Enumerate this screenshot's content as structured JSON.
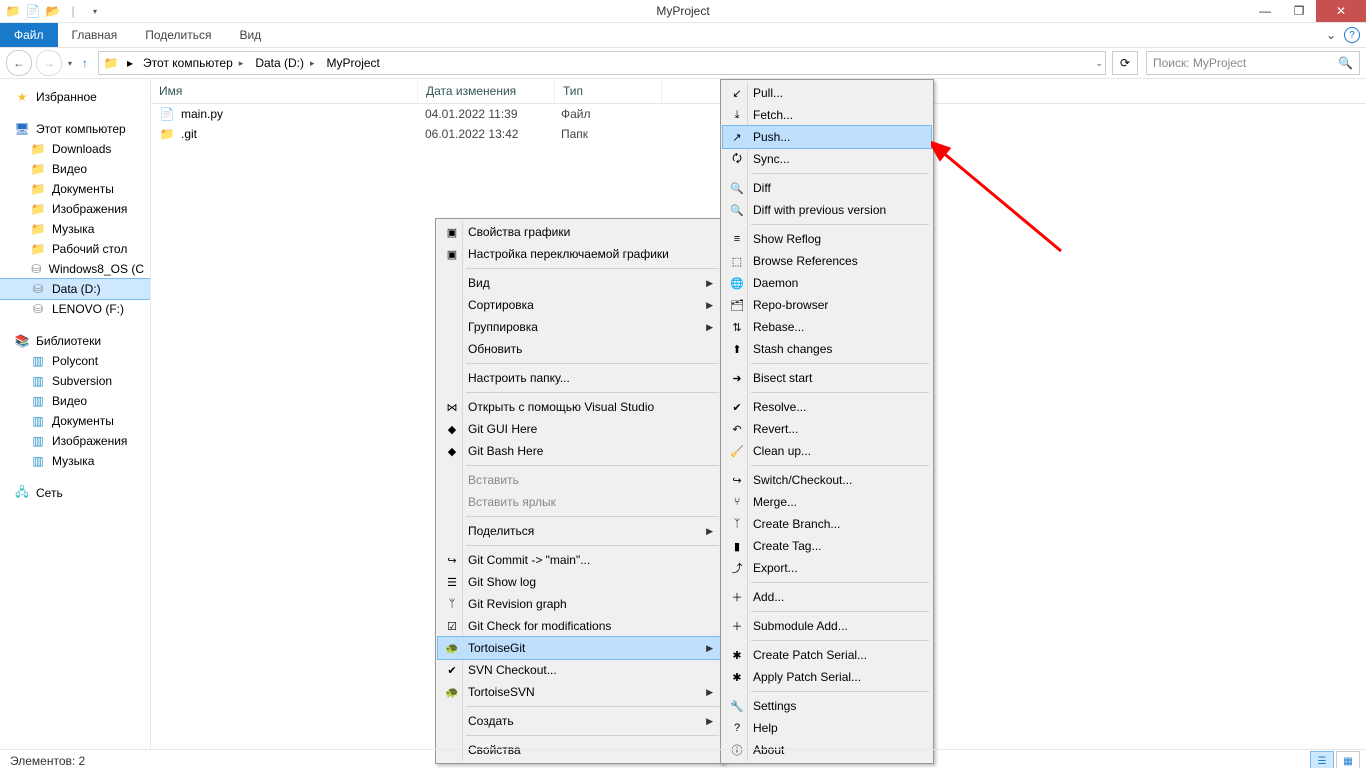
{
  "window": {
    "title": "MyProject"
  },
  "ribbon": {
    "file_tab": "Файл",
    "tabs": [
      "Главная",
      "Поделиться",
      "Вид"
    ]
  },
  "breadcrumb": {
    "segs": [
      "Этот компьютер",
      "Data (D:)",
      "MyProject"
    ]
  },
  "search": {
    "placeholder": "Поиск: MyProject"
  },
  "sidebar": {
    "favorites": {
      "label": "Избранное"
    },
    "this_pc": {
      "label": "Этот компьютер",
      "items": [
        "Downloads",
        "Видео",
        "Документы",
        "Изображения",
        "Музыка",
        "Рабочий стол",
        "Windows8_OS (C",
        "Data (D:)",
        "LENOVO (F:)"
      ]
    },
    "libraries": {
      "label": "Библиотеки",
      "items": [
        "Polycont",
        "Subversion",
        "Видео",
        "Документы",
        "Изображения",
        "Музыка"
      ]
    },
    "network": {
      "label": "Сеть"
    }
  },
  "columns": {
    "name": "Имя",
    "date": "Дата изменения",
    "type": "Тип"
  },
  "files": [
    {
      "name": "main.py",
      "date": "04.01.2022 11:39",
      "type": "Файл"
    },
    {
      "name": ".git",
      "date": "06.01.2022 13:42",
      "type": "Папк"
    }
  ],
  "ctx1": {
    "items": [
      {
        "t": "Свойства графики",
        "ico": "amd"
      },
      {
        "t": "Настройка переключаемой графики",
        "ico": "amd"
      },
      {
        "sep": true
      },
      {
        "t": "Вид",
        "sub": true
      },
      {
        "t": "Сортировка",
        "sub": true
      },
      {
        "t": "Группировка",
        "sub": true
      },
      {
        "t": "Обновить"
      },
      {
        "sep": true
      },
      {
        "t": "Настроить папку..."
      },
      {
        "sep": true
      },
      {
        "t": "Открыть с помощью Visual Studio",
        "ico": "vs"
      },
      {
        "t": "Git GUI Here",
        "ico": "git"
      },
      {
        "t": "Git Bash Here",
        "ico": "git"
      },
      {
        "sep": true
      },
      {
        "t": "Вставить",
        "dis": true
      },
      {
        "t": "Вставить ярлык",
        "dis": true
      },
      {
        "sep": true
      },
      {
        "t": "Поделиться",
        "sub": true
      },
      {
        "sep": true
      },
      {
        "t": "Git Commit -> \"main\"...",
        "ico": "commit"
      },
      {
        "t": "Git Show log",
        "ico": "log"
      },
      {
        "t": "Git Revision graph",
        "ico": "graph"
      },
      {
        "t": "Git Check for modifications",
        "ico": "chk"
      },
      {
        "t": "TortoiseGit",
        "ico": "tgit",
        "sub": true,
        "hl": true
      },
      {
        "t": "SVN Checkout...",
        "ico": "svn"
      },
      {
        "t": "TortoiseSVN",
        "ico": "tsvn",
        "sub": true
      },
      {
        "sep": true
      },
      {
        "t": "Создать",
        "sub": true
      },
      {
        "sep": true
      },
      {
        "t": "Свойства"
      }
    ]
  },
  "ctx2": {
    "items": [
      {
        "t": "Pull...",
        "ico": "pull"
      },
      {
        "t": "Fetch...",
        "ico": "fetch"
      },
      {
        "t": "Push...",
        "ico": "push",
        "hl": true
      },
      {
        "t": "Sync...",
        "ico": "sync"
      },
      {
        "sep": true
      },
      {
        "t": "Diff",
        "ico": "diff"
      },
      {
        "t": "Diff with previous version",
        "ico": "diff"
      },
      {
        "sep": true
      },
      {
        "t": "Show Reflog",
        "ico": "reflog"
      },
      {
        "t": "Browse References",
        "ico": "bref"
      },
      {
        "t": "Daemon",
        "ico": "daemon"
      },
      {
        "t": "Repo-browser",
        "ico": "repo"
      },
      {
        "t": "Rebase...",
        "ico": "rebase"
      },
      {
        "t": "Stash changes",
        "ico": "stash"
      },
      {
        "sep": true
      },
      {
        "t": "Bisect start",
        "ico": "bisect"
      },
      {
        "sep": true
      },
      {
        "t": "Resolve...",
        "ico": "resolve"
      },
      {
        "t": "Revert...",
        "ico": "revert"
      },
      {
        "t": "Clean up...",
        "ico": "clean"
      },
      {
        "sep": true
      },
      {
        "t": "Switch/Checkout...",
        "ico": "switch"
      },
      {
        "t": "Merge...",
        "ico": "merge"
      },
      {
        "t": "Create Branch...",
        "ico": "branch"
      },
      {
        "t": "Create Tag...",
        "ico": "tag"
      },
      {
        "t": "Export...",
        "ico": "export"
      },
      {
        "sep": true
      },
      {
        "t": "Add...",
        "ico": "add"
      },
      {
        "sep": true
      },
      {
        "t": "Submodule Add...",
        "ico": "submod"
      },
      {
        "sep": true
      },
      {
        "t": "Create Patch Serial...",
        "ico": "patch"
      },
      {
        "t": "Apply Patch Serial...",
        "ico": "apatch"
      },
      {
        "sep": true
      },
      {
        "t": "Settings",
        "ico": "settings"
      },
      {
        "t": "Help",
        "ico": "help"
      },
      {
        "t": "About",
        "ico": "about"
      }
    ]
  },
  "status": {
    "text": "Элементов: 2"
  },
  "icons": {
    "pull": "↙",
    "fetch": "⤓",
    "push": "↗",
    "sync": "🗘",
    "diff": "🔍",
    "reflog": "≡",
    "bref": "⬚",
    "daemon": "🌐",
    "repo": "🗂",
    "rebase": "⇅",
    "stash": "⬆",
    "bisect": "➜",
    "resolve": "✔",
    "revert": "↶",
    "clean": "🧹",
    "switch": "↪",
    "merge": "⑂",
    "branch": "ᛉ",
    "tag": "▮",
    "export": "⤴",
    "add": "＋",
    "submod": "＋",
    "patch": "✱",
    "apatch": "✱",
    "settings": "🔧",
    "help": "?",
    "about": "ⓘ",
    "amd": "▣",
    "vs": "⋈",
    "git": "◆",
    "commit": "↪",
    "log": "☰",
    "graph": "ᛘ",
    "chk": "☑",
    "tgit": "🐢",
    "svn": "✔",
    "tsvn": "🐢"
  }
}
